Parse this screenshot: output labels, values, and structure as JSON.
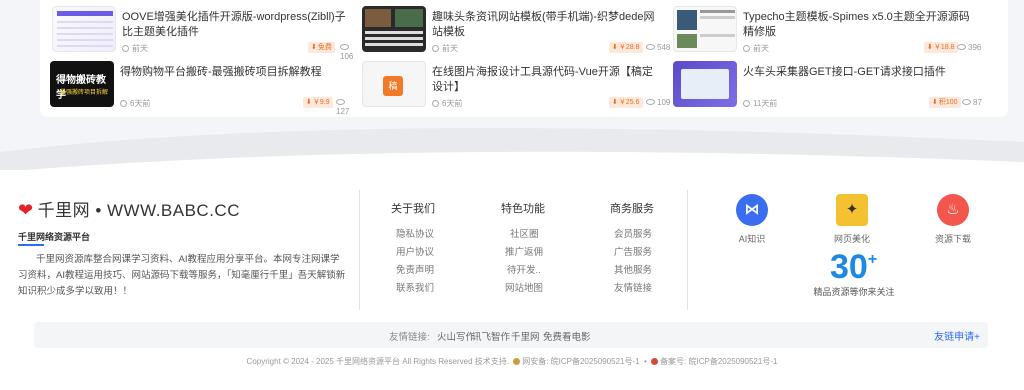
{
  "cards": [
    {
      "title": "OOVE增强美化插件开源版-wordpress(Zibll)子比主题美化插件",
      "time": "前天",
      "price": "免费",
      "views": "106"
    },
    {
      "title": "趣味头条资讯网站模板(带手机端)-织梦dede网站模板",
      "time": "前天",
      "price": "￥28.8",
      "views": "548"
    },
    {
      "title": "Typecho主题模板-Spimes x5.0主题全开源源码精修版",
      "time": "前天",
      "price": "￥18.8",
      "views": "396"
    },
    {
      "title": "得物购物平台搬砖-最强搬砖项目拆解教程",
      "time": "6天前",
      "price": "￥9.9",
      "views": "127",
      "thumb_text": "得物搬砖教学",
      "thumb_sub": "最强搬砖项目拆解"
    },
    {
      "title": "在线图片海报设计工具源代码-Vue开源【稿定设计】",
      "time": "6天前",
      "price": "￥25.6",
      "views": "109"
    },
    {
      "title": "火车头采集器GET接口-GET请求接口插件",
      "time": "11天前",
      "price": "积100",
      "views": "87"
    }
  ],
  "footer": {
    "brand": "千里网 • WWW.BABC.CC",
    "brand_sub": "千里网络资源平台",
    "description": "千里网资源库整合网课学习资料、AI教程应用分享平台。本网专注网课学习资料，AI教程运用技巧、网站源码下载等服务，「知毫厘行千里」吾天解锁新知识积少成多学以致用！！",
    "columns": [
      {
        "head": "关于我们",
        "links": [
          "隐私协议",
          "用户协议",
          "免责声明",
          "联系我们"
        ]
      },
      {
        "head": "特色功能",
        "links": [
          "社区圈",
          "推广返佣",
          "待开发..",
          "网站地图"
        ]
      },
      {
        "head": "商务服务",
        "links": [
          "会员服务",
          "广告服务",
          "其他服务",
          "友情链接"
        ]
      }
    ],
    "features": [
      {
        "label": "AI知识",
        "icon": "ai-knowledge-icon",
        "color": "#3a6df0"
      },
      {
        "label": "网页美化",
        "icon": "magic-wand-icon",
        "color": "#f4c230"
      },
      {
        "label": "资源下载",
        "icon": "fire-icon",
        "color": "#f2564c"
      }
    ],
    "big_number": "30",
    "big_number_suffix": "+",
    "big_number_caption": "精品资源等你来关注",
    "friend_label": "友情链接:",
    "friend_links": [
      "火山写作",
      "讯飞智作",
      "千里网",
      "免费看电影"
    ],
    "friend_apply": "友链申请+",
    "copyright": "Copyright © 2024 - 2025 千里网络资源平台 All Rights Reserved 技术支持.",
    "icp1": "网安备: 皖ICP备2025090521号-1",
    "icp2": "备案号: 皖ICP备2025090521号-1"
  }
}
